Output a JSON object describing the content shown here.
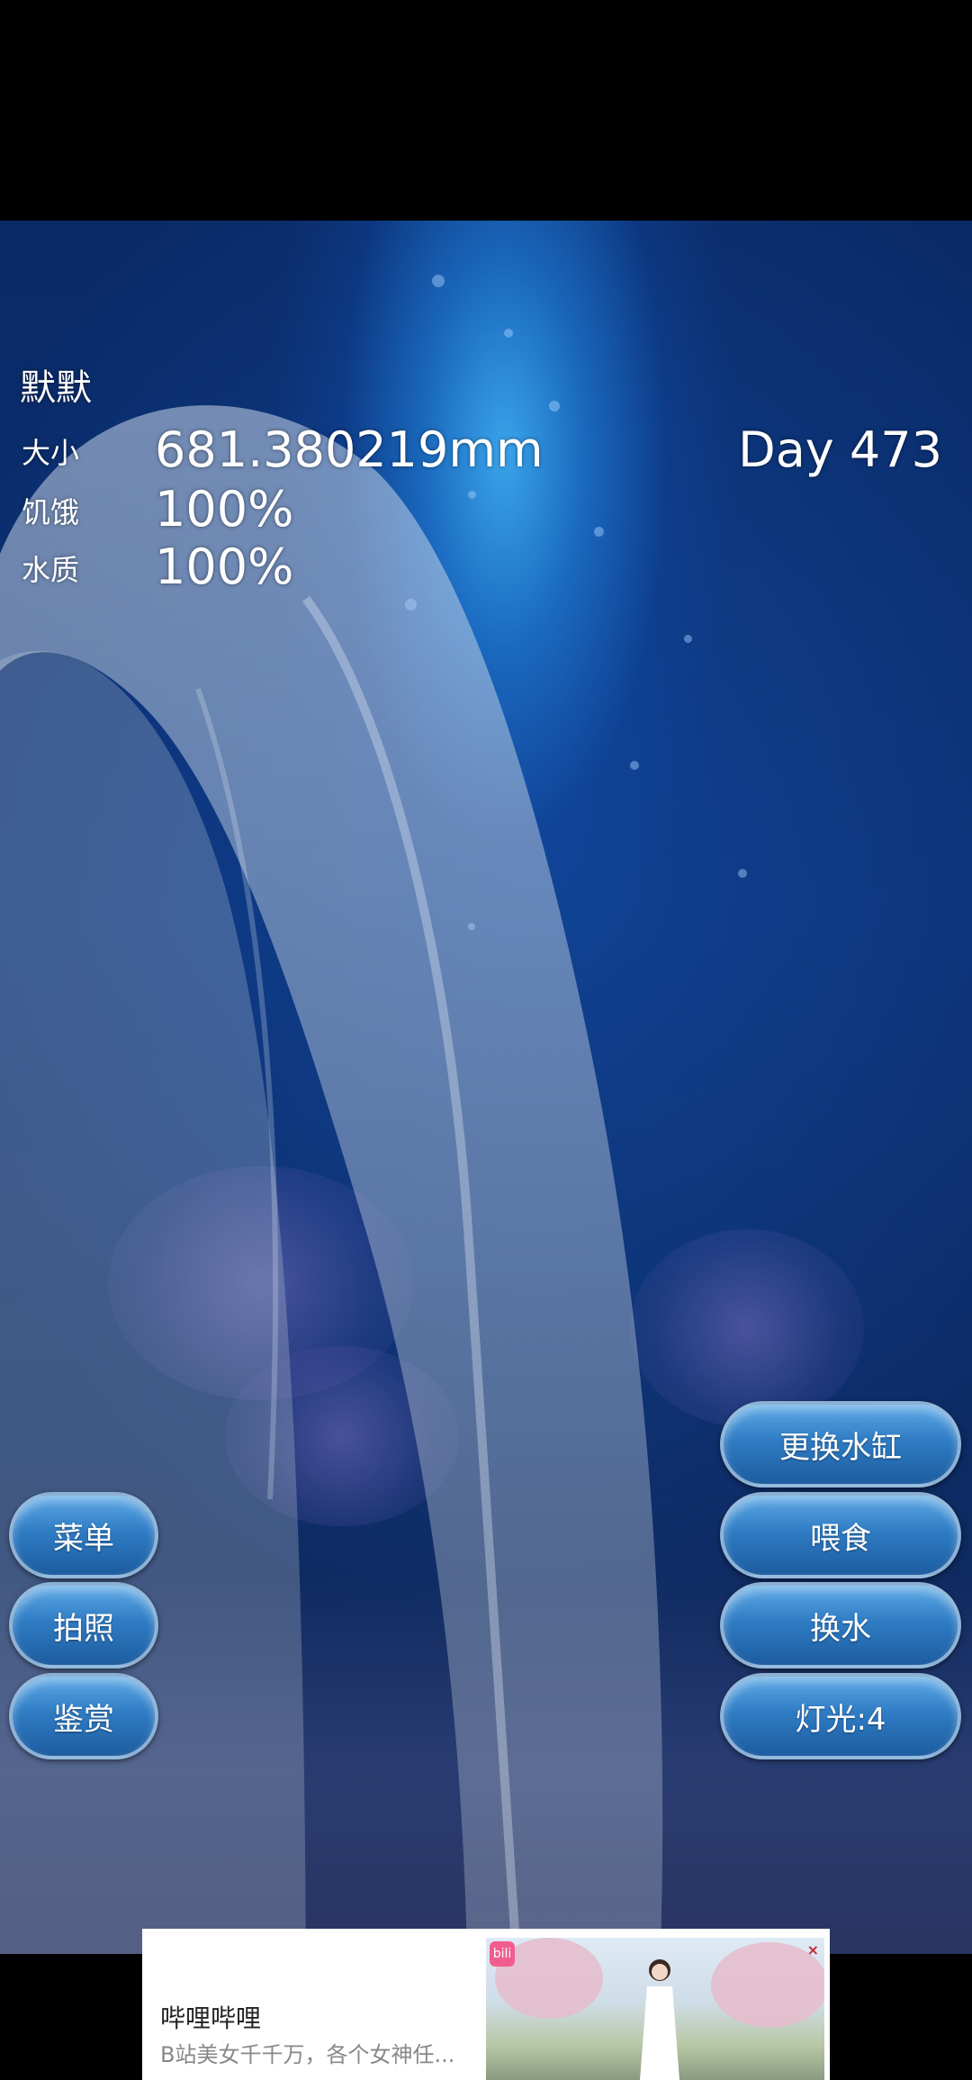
{
  "pet": {
    "name": "默默",
    "day": "Day 473"
  },
  "stats": {
    "size_label": "大小",
    "size_value": "681.380219mm",
    "hunger_label": "饥饿",
    "hunger_value": "100%",
    "water_label": "水质",
    "water_value": "100%"
  },
  "left_buttons": {
    "menu": "菜单",
    "photo": "拍照",
    "gallery": "鉴赏"
  },
  "right_buttons": {
    "change_tank": "更换水缸",
    "feed": "喂食",
    "change_water": "换水",
    "light": "灯光:4"
  },
  "ad": {
    "title": "哔哩哔哩",
    "description": "B站美女千千万，各个女神任...",
    "app_icon_text": "bili",
    "close_icon": "×"
  },
  "colors": {
    "button_gradient_top": "#5ea9e6",
    "button_gradient_bottom": "#1c5c9f",
    "tank_light": "#3caaf0",
    "tank_deep": "#0a2a66"
  }
}
